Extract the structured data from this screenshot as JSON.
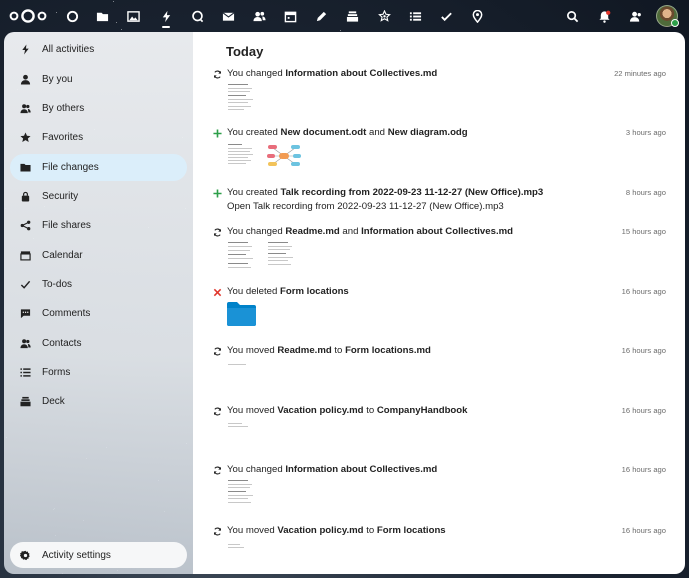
{
  "nav": {
    "apps": [
      {
        "name": "dashboard",
        "icon": "circle-icon"
      },
      {
        "name": "files",
        "icon": "folder-icon"
      },
      {
        "name": "photos",
        "icon": "image-icon"
      },
      {
        "name": "activity",
        "icon": "lightning-icon"
      },
      {
        "name": "talk",
        "icon": "chat-bubble-icon"
      },
      {
        "name": "mail",
        "icon": "mail-icon"
      },
      {
        "name": "contacts",
        "icon": "contacts-icon"
      },
      {
        "name": "calendar",
        "icon": "calendar-icon"
      },
      {
        "name": "notes",
        "icon": "pencil-icon"
      },
      {
        "name": "deck",
        "icon": "deck-icon"
      },
      {
        "name": "collectives",
        "icon": "star-people-icon"
      },
      {
        "name": "forms",
        "icon": "list-icon"
      },
      {
        "name": "tasks",
        "icon": "check-icon"
      },
      {
        "name": "maps",
        "icon": "map-pin-icon"
      }
    ],
    "right": [
      {
        "name": "search",
        "icon": "search-icon"
      },
      {
        "name": "notifications",
        "icon": "bell-icon"
      },
      {
        "name": "contacts-menu",
        "icon": "contacts-icon"
      }
    ]
  },
  "sidebar": {
    "items": [
      {
        "label": "All activities",
        "icon": "lightning-icon"
      },
      {
        "label": "By you",
        "icon": "person-icon"
      },
      {
        "label": "By others",
        "icon": "people-icon"
      },
      {
        "label": "Favorites",
        "icon": "star-icon"
      },
      {
        "label": "File changes",
        "icon": "folder-icon",
        "active": true
      },
      {
        "label": "Security",
        "icon": "lock-icon"
      },
      {
        "label": "File shares",
        "icon": "share-icon"
      },
      {
        "label": "Calendar",
        "icon": "calendar-icon"
      },
      {
        "label": "To-dos",
        "icon": "check-icon"
      },
      {
        "label": "Comments",
        "icon": "comment-icon"
      },
      {
        "label": "Contacts",
        "icon": "contacts-icon"
      },
      {
        "label": "Forms",
        "icon": "list-icon"
      },
      {
        "label": "Deck",
        "icon": "deck-icon"
      }
    ],
    "settings_label": "Activity settings"
  },
  "main": {
    "heading": "Today",
    "activities": [
      {
        "type": "changed",
        "parts": [
          "You changed ",
          "Information about Collectives.md"
        ],
        "time": "22 minutes ago"
      },
      {
        "type": "created",
        "parts": [
          "You created ",
          "New document.odt",
          " and ",
          "New diagram.odg"
        ],
        "time": "3 hours ago"
      },
      {
        "type": "created",
        "parts": [
          "You created ",
          "Talk recording from 2022-09-23 11-12-27 (New Office).mp3"
        ],
        "time": "8 hours ago",
        "message": "Open Talk recording from 2022-09-23 11-12-27 (New Office).mp3"
      },
      {
        "type": "changed",
        "parts": [
          "You changed ",
          "Readme.md",
          " and ",
          "Information about Collectives.md"
        ],
        "time": "15 hours ago"
      },
      {
        "type": "deleted",
        "parts": [
          "You deleted ",
          "Form locations"
        ],
        "time": "16 hours ago"
      },
      {
        "type": "changed",
        "parts": [
          "You moved ",
          "Readme.md",
          " to ",
          "Form locations.md"
        ],
        "time": "16 hours ago"
      },
      {
        "type": "changed",
        "parts": [
          "You moved ",
          "Vacation policy.md",
          " to ",
          "CompanyHandbook"
        ],
        "time": "16 hours ago"
      },
      {
        "type": "changed",
        "parts": [
          "You changed ",
          "Information about Collectives.md"
        ],
        "time": "16 hours ago"
      },
      {
        "type": "changed",
        "parts": [
          "You moved ",
          "Vacation policy.md",
          " to ",
          "Form locations"
        ],
        "time": "16 hours ago"
      }
    ]
  },
  "colors": {
    "accent_active_bg": "#dbeefa",
    "created_icon": "#2d9f4a",
    "deleted_icon": "#e0352b",
    "folder": "#0082c9",
    "time_text": "#6b6b6b"
  }
}
